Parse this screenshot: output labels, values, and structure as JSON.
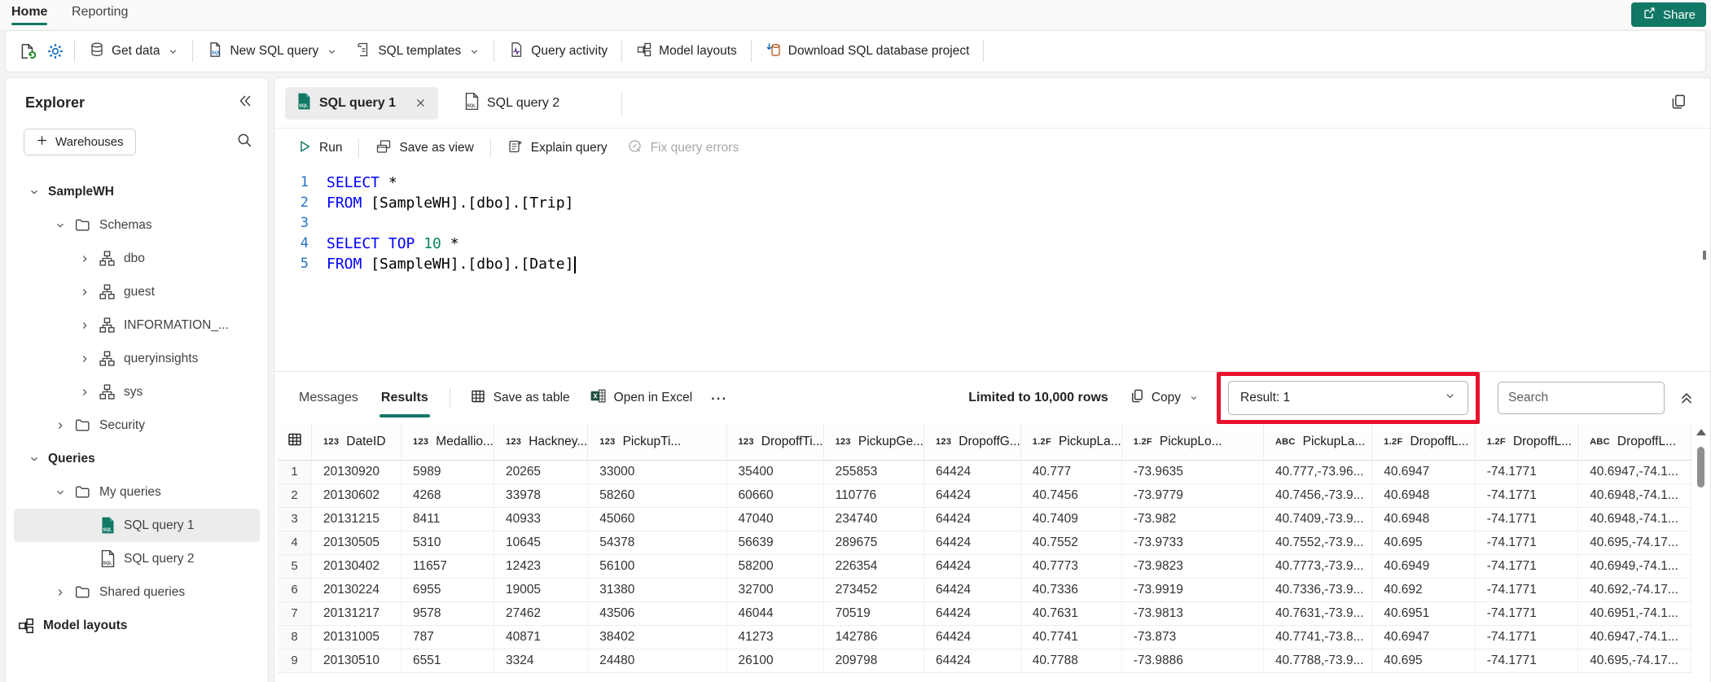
{
  "nav": {
    "tabs": [
      {
        "label": "Home",
        "active": true
      },
      {
        "label": "Reporting",
        "active": false
      }
    ],
    "share_label": "Share"
  },
  "ribbon": {
    "get_data": "Get data",
    "new_sql_query": "New SQL query",
    "sql_templates": "SQL templates",
    "query_activity": "Query activity",
    "model_layouts": "Model layouts",
    "download_project": "Download SQL database project"
  },
  "explorer": {
    "title": "Explorer",
    "warehouses_button": "Warehouses",
    "tree": [
      {
        "label": "SampleWH",
        "depth": "d0",
        "chevron": "down",
        "glyph": "",
        "weight": "w600"
      },
      {
        "label": "Schemas",
        "depth": "d1",
        "chevron": "down",
        "glyph": "folder",
        "weight": ""
      },
      {
        "label": "dbo",
        "depth": "d2",
        "chevron": "right",
        "glyph": "schema",
        "weight": ""
      },
      {
        "label": "guest",
        "depth": "d2",
        "chevron": "right",
        "glyph": "schema",
        "weight": ""
      },
      {
        "label": "INFORMATION_...",
        "depth": "d2",
        "chevron": "right",
        "glyph": "schema",
        "weight": ""
      },
      {
        "label": "queryinsights",
        "depth": "d2",
        "chevron": "right",
        "glyph": "schema",
        "weight": ""
      },
      {
        "label": "sys",
        "depth": "d2",
        "chevron": "right",
        "glyph": "schema",
        "weight": ""
      },
      {
        "label": "Security",
        "depth": "d1",
        "chevron": "right",
        "glyph": "folder",
        "weight": ""
      },
      {
        "label": "Queries",
        "depth": "d0",
        "chevron": "down",
        "glyph": "",
        "weight": "w600"
      },
      {
        "label": "My queries",
        "depth": "d1",
        "chevron": "down",
        "glyph": "folder",
        "weight": ""
      },
      {
        "label": "SQL query 1",
        "depth": "d2 nochev",
        "chevron": "",
        "glyph": "sql-green",
        "weight": "",
        "selected": true
      },
      {
        "label": "SQL query 2",
        "depth": "d2 nochev",
        "chevron": "",
        "glyph": "sql-outline",
        "weight": ""
      },
      {
        "label": "Shared queries",
        "depth": "d1",
        "chevron": "right",
        "glyph": "folder",
        "weight": ""
      },
      {
        "label": "Model layouts",
        "depth": "droot-icon",
        "chevron": "",
        "glyph": "model",
        "weight": "w600"
      }
    ]
  },
  "editor_tabs": [
    {
      "label": "SQL query 1",
      "icon": "sql-green",
      "active": true
    },
    {
      "label": "SQL query 2",
      "icon": "sql-outline",
      "active": false
    }
  ],
  "query_toolbar": {
    "run": "Run",
    "save_as_view": "Save as view",
    "explain_query": "Explain query",
    "fix_query_errors": "Fix query errors"
  },
  "editor": {
    "lines": [
      {
        "n": "1",
        "seg": [
          {
            "c": "kw",
            "t": "SELECT"
          },
          {
            "c": "pl",
            "t": " *"
          }
        ]
      },
      {
        "n": "2",
        "seg": [
          {
            "c": "kw",
            "t": "FROM"
          },
          {
            "c": "pl",
            "t": " [SampleWH].[dbo].[Trip]"
          }
        ]
      },
      {
        "n": "3",
        "seg": []
      },
      {
        "n": "4",
        "seg": [
          {
            "c": "kw",
            "t": "SELECT TOP "
          },
          {
            "c": "num",
            "t": "10"
          },
          {
            "c": "pl",
            "t": " *"
          }
        ]
      },
      {
        "n": "5",
        "seg": [
          {
            "c": "kw",
            "t": "FROM"
          },
          {
            "c": "pl",
            "t": " [SampleWH].[dbo].[Date]"
          }
        ],
        "cursor": true
      }
    ]
  },
  "results": {
    "tabs": [
      {
        "label": "Messages",
        "active": false
      },
      {
        "label": "Results",
        "active": true
      }
    ],
    "save_as_table": "Save as table",
    "open_in_excel": "Open in Excel",
    "overflow": "⋯",
    "limit_text": "Limited to 10,000 rows",
    "copy_label": "Copy",
    "result_selector": "Result: 1",
    "search_placeholder": "Search",
    "grid": {
      "columns": [
        {
          "type": "123",
          "label": "DateID"
        },
        {
          "type": "123",
          "label": "Medallio..."
        },
        {
          "type": "123",
          "label": "Hackney..."
        },
        {
          "type": "123",
          "label": "PickupTi..."
        },
        {
          "type": "123",
          "label": "DropoffTi..."
        },
        {
          "type": "123",
          "label": "PickupGe..."
        },
        {
          "type": "123",
          "label": "DropoffG..."
        },
        {
          "type": "1.2F",
          "label": "PickupLa..."
        },
        {
          "type": "1.2F",
          "label": "PickupLo..."
        },
        {
          "type": "ABC",
          "label": "PickupLa..."
        },
        {
          "type": "1.2F",
          "label": "DropoffL..."
        },
        {
          "type": "1.2F",
          "label": "DropoffL..."
        },
        {
          "type": "ABC",
          "label": "DropoffL..."
        }
      ],
      "rows": [
        {
          "n": "1",
          "cells": [
            "20130920",
            "5989",
            "20265",
            "33000",
            "35400",
            "255853",
            "64424",
            "40.777",
            "-73.9635",
            "40.777,-73.96...",
            "40.6947",
            "-74.1771",
            "40.6947,-74.1..."
          ]
        },
        {
          "n": "2",
          "cells": [
            "20130602",
            "4268",
            "33978",
            "58260",
            "60660",
            "110776",
            "64424",
            "40.7456",
            "-73.9779",
            "40.7456,-73.9...",
            "40.6948",
            "-74.1771",
            "40.6948,-74.1..."
          ]
        },
        {
          "n": "3",
          "cells": [
            "20131215",
            "8411",
            "40933",
            "45060",
            "47040",
            "234740",
            "64424",
            "40.7409",
            "-73.982",
            "40.7409,-73.9...",
            "40.6948",
            "-74.1771",
            "40.6948,-74.1..."
          ]
        },
        {
          "n": "4",
          "cells": [
            "20130505",
            "5310",
            "10645",
            "54378",
            "56639",
            "289675",
            "64424",
            "40.7552",
            "-73.9733",
            "40.7552,-73.9...",
            "40.695",
            "-74.1771",
            "40.695,-74.17..."
          ]
        },
        {
          "n": "5",
          "cells": [
            "20130402",
            "11657",
            "12423",
            "56100",
            "58200",
            "226354",
            "64424",
            "40.7773",
            "-73.9823",
            "40.7773,-73.9...",
            "40.6949",
            "-74.1771",
            "40.6949,-74.1..."
          ]
        },
        {
          "n": "6",
          "cells": [
            "20130224",
            "6955",
            "19005",
            "31380",
            "32700",
            "273452",
            "64424",
            "40.7336",
            "-73.9919",
            "40.7336,-73.9...",
            "40.692",
            "-74.1771",
            "40.692,-74.17..."
          ]
        },
        {
          "n": "7",
          "cells": [
            "20131217",
            "9578",
            "27462",
            "43506",
            "46044",
            "70519",
            "64424",
            "40.7631",
            "-73.9813",
            "40.7631,-73.9...",
            "40.6951",
            "-74.1771",
            "40.6951,-74.1..."
          ]
        },
        {
          "n": "8",
          "cells": [
            "20131005",
            "787",
            "40871",
            "38402",
            "41273",
            "142786",
            "64424",
            "40.7741",
            "-73.873",
            "40.7741,-73.8...",
            "40.6947",
            "-74.1771",
            "40.6947,-74.1..."
          ]
        },
        {
          "n": "9",
          "cells": [
            "20130510",
            "6551",
            "3324",
            "24480",
            "26100",
            "209798",
            "64424",
            "40.7788",
            "-73.9886",
            "40.7788,-73.9...",
            "40.695",
            "-74.1771",
            "40.695,-74.17..."
          ]
        }
      ]
    }
  }
}
